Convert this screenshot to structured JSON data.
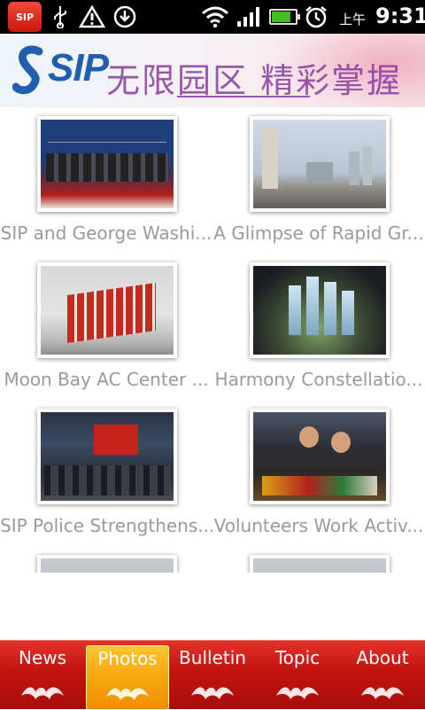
{
  "status_bar": {
    "app_badge": "SIP",
    "time_prefix": "上午",
    "time": "9:31",
    "battery_level": 0.8,
    "icons": [
      "sip-app-icon",
      "usb-icon",
      "warning-icon",
      "download-icon",
      "wifi-icon",
      "signal-icon",
      "battery-icon",
      "alarm-icon"
    ]
  },
  "banner": {
    "logo_text": "SIP",
    "slogan": "无限园区 精彩掌握",
    "brand_color": "#1f5fae"
  },
  "photos": [
    {
      "caption": "SIP and George Washi...",
      "thumbnail": "ceremony"
    },
    {
      "caption": "A Glimpse of Rapid Gr...",
      "thumbnail": "city"
    },
    {
      "caption": "Moon Bay AC Center ...",
      "thumbnail": "bay"
    },
    {
      "caption": "Harmony Constellatio...",
      "thumbnail": "model"
    },
    {
      "caption": "SIP Police Strengthens...",
      "thumbnail": "police"
    },
    {
      "caption": "Volunteers Work Activ...",
      "thumbnail": "volunteer"
    },
    {
      "caption": "",
      "thumbnail": "partial"
    },
    {
      "caption": "",
      "thumbnail": "partial"
    }
  ],
  "tabs": [
    {
      "label": "News",
      "active": false
    },
    {
      "label": "Photos",
      "active": true
    },
    {
      "label": "Bulletin",
      "active": false
    },
    {
      "label": "Topic",
      "active": false
    },
    {
      "label": "About",
      "active": false
    }
  ],
  "colors": {
    "tab_bar": "#c2130f",
    "tab_active": "#f7a60e",
    "caption_text": "#9a9a9a"
  }
}
